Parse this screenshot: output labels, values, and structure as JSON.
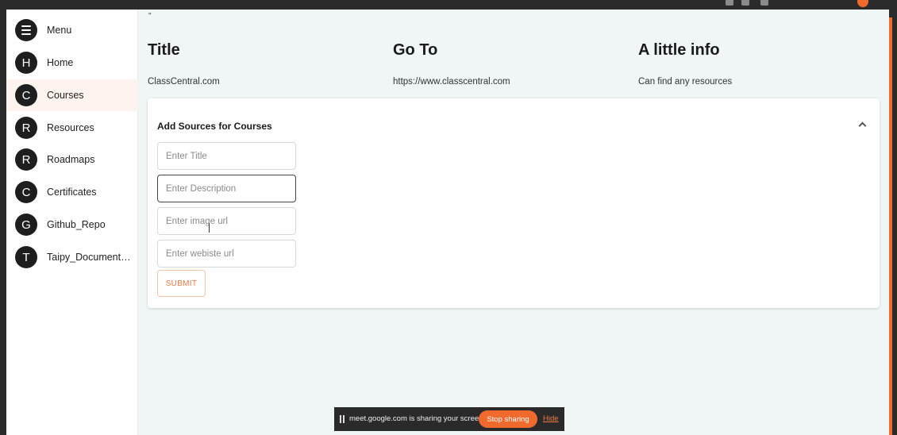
{
  "sidebar": {
    "items": [
      {
        "initial": "",
        "label": "Menu",
        "icon": "menu-icon"
      },
      {
        "initial": "H",
        "label": "Home"
      },
      {
        "initial": "C",
        "label": "Courses",
        "active": true
      },
      {
        "initial": "R",
        "label": "Resources"
      },
      {
        "initial": "R",
        "label": "Roadmaps"
      },
      {
        "initial": "C",
        "label": "Certificates"
      },
      {
        "initial": "G",
        "label": "Github_Repo"
      },
      {
        "initial": "T",
        "label": "Taipy_Documentati..."
      }
    ]
  },
  "main": {
    "quote": "\"",
    "columns": [
      {
        "header": "Title",
        "value": "ClassCentral.com"
      },
      {
        "header": "Go To",
        "value": "https://www.classcentral.com"
      },
      {
        "header": "A little info",
        "value": "Can find any resources"
      }
    ],
    "form": {
      "title": "Add Sources for Courses",
      "fields": {
        "title_placeholder": "Enter Title",
        "description_placeholder": "Enter Description",
        "image_placeholder": "Enter image url",
        "website_placeholder": "Enter webiste url"
      },
      "submit_label": "SUBMIT"
    }
  },
  "share_bar": {
    "message": "meet.google.com is sharing your screen.",
    "stop_label": "Stop sharing",
    "hide_label": "Hide"
  },
  "colors": {
    "accent": "#f06a2e",
    "background": "#f0f5f5",
    "avatar": "#1e1e1e"
  }
}
